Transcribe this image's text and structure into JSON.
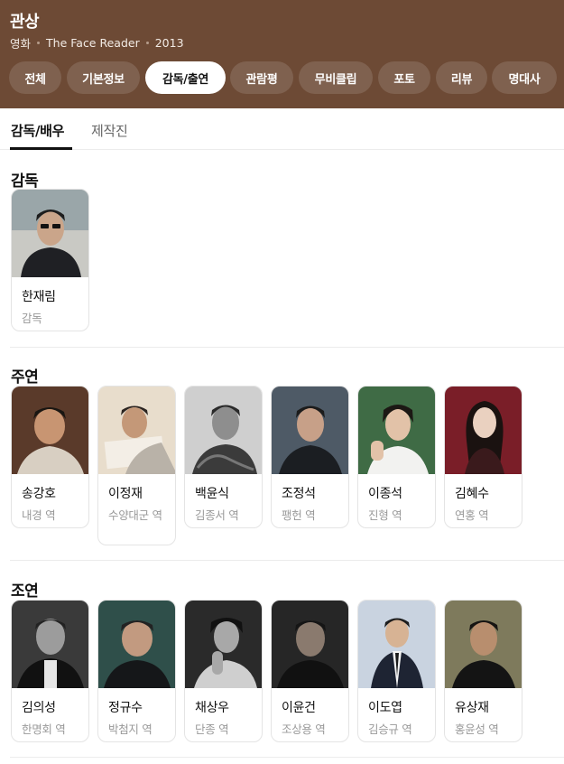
{
  "header": {
    "title": "관상",
    "meta": [
      "영화",
      "The Face Reader",
      "2013"
    ]
  },
  "tabs": [
    "전체",
    "기본정보",
    "감독/출연",
    "관람평",
    "무비클립",
    "포토",
    "리뷰",
    "명대사"
  ],
  "active_tab": "감독/출연",
  "subtabs": [
    "감독/배우",
    "제작진"
  ],
  "sections": {
    "director": {
      "title": "감독",
      "people": [
        {
          "name": "한재림",
          "role": "감독"
        }
      ]
    },
    "lead": {
      "title": "주연",
      "people": [
        {
          "name": "송강호",
          "role": "내경 역"
        },
        {
          "name": "이정재",
          "role": "수양대군 역"
        },
        {
          "name": "백윤식",
          "role": "김종서 역"
        },
        {
          "name": "조정석",
          "role": "팽헌 역"
        },
        {
          "name": "이종석",
          "role": "진형 역"
        },
        {
          "name": "김혜수",
          "role": "연홍 역"
        }
      ]
    },
    "supporting": {
      "title": "조연",
      "people": [
        {
          "name": "김의성",
          "role": "한명회 역"
        },
        {
          "name": "정규수",
          "role": "박첨지 역"
        },
        {
          "name": "채상우",
          "role": "단종 역"
        },
        {
          "name": "이윤건",
          "role": "조상용 역"
        },
        {
          "name": "이도엽",
          "role": "김승규 역"
        },
        {
          "name": "유상재",
          "role": "홍윤성 역"
        }
      ]
    }
  },
  "colors": {
    "header_bg": "#6d4a35",
    "active_tab_bg": "#ffffff"
  }
}
